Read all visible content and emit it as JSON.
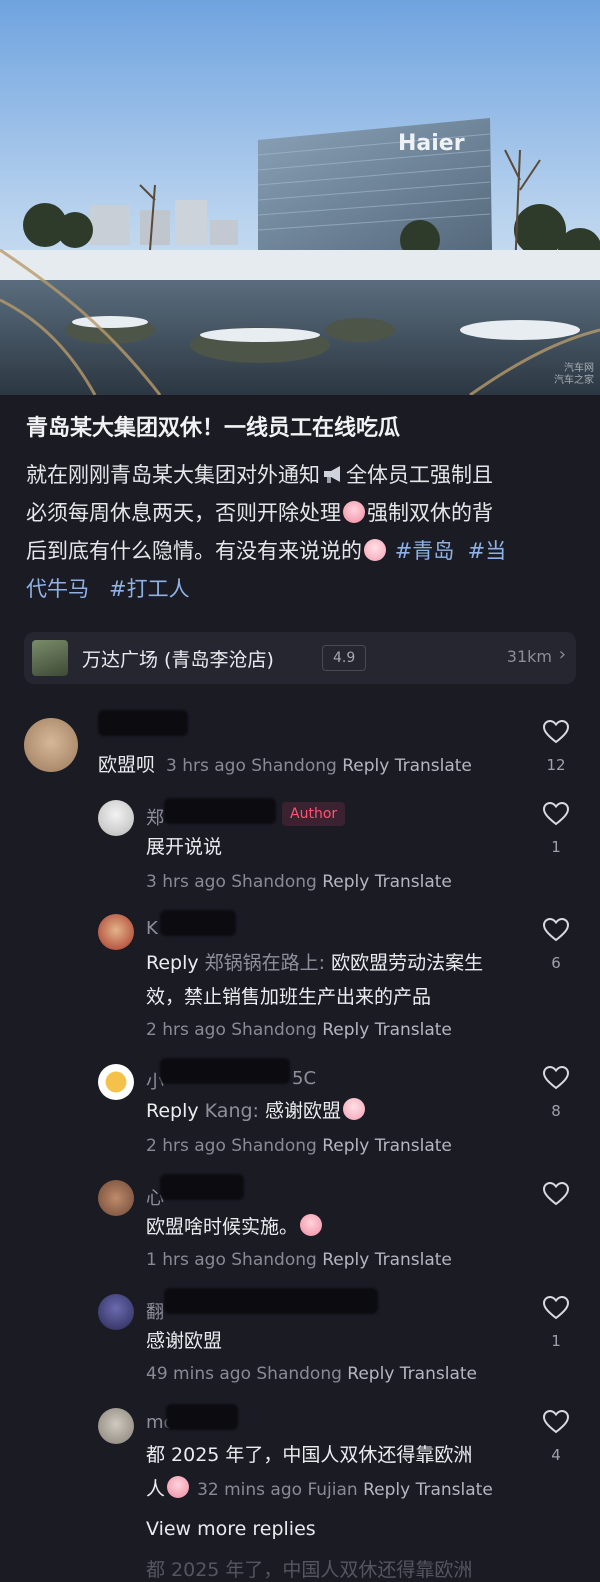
{
  "post": {
    "title": "青岛某大集团双休！一线员工在线吃瓜",
    "body_line1": "就在刚刚青岛某大集团对外通知",
    "body_line1b": "全体员工强制且",
    "body_line2": "必须每周休息两天，否则开除处理",
    "body_line2b": "强制双休的背",
    "body_line3": "后到底有什么隐情。有没有来说说的",
    "tag1": "#青岛",
    "tag2": "#当",
    "tag2b": "代牛马",
    "tag3": "#打工人",
    "hero_sign": "Haier",
    "watermark1": "汽车网",
    "watermark2": "汽车之家"
  },
  "location": {
    "name": "万达广场 (青岛李沧店)",
    "score": "4.9",
    "distance": "31km",
    "chevron": ">"
  },
  "comments": [
    {
      "name_visible": "",
      "text": "欧盟呗",
      "meta_time": "3 hrs ago",
      "meta_region": "Shandong",
      "reply": "Reply",
      "translate": "Translate",
      "likes": "12"
    },
    {
      "name_visible": "郑",
      "author_badge": "Author",
      "text": "展开说说",
      "meta_time": "3 hrs ago",
      "meta_region": "Shandong",
      "reply": "Reply",
      "translate": "Translate",
      "likes": "1"
    },
    {
      "name_visible": "K",
      "reply_prefix": "Reply",
      "reply_to": "郑锅锅在路上:",
      "text_line1": "欧欧盟劳动法案生",
      "text_line2": "效，禁止销售加班生产出来的产品",
      "meta_time": "2 hrs ago",
      "meta_region": "Shandong",
      "reply": "Reply",
      "translate": "Translate",
      "likes": "6"
    },
    {
      "name_visible": "小",
      "name_tail": "5C",
      "reply_prefix": "Reply",
      "reply_to": "Kang:",
      "text": "感谢欧盟",
      "meta_time": "2 hrs ago",
      "meta_region": "Shandong",
      "reply": "Reply",
      "translate": "Translate",
      "likes": "8"
    },
    {
      "name_visible": "心",
      "text": "欧盟啥时候实施。",
      "meta_time": "1 hrs ago",
      "meta_region": "Shandong",
      "reply": "Reply",
      "translate": "Translate",
      "likes": ""
    },
    {
      "name_visible": "翻",
      "text": "感谢欧盟",
      "meta_time": "49 mins ago",
      "meta_region": "Shandong",
      "reply": "Reply",
      "translate": "Translate",
      "likes": "1"
    },
    {
      "name_visible": "mo",
      "text_line1": "都 2025 年了，中国人双休还得靠欧洲",
      "text_line2": "人",
      "meta_time": "32 mins ago",
      "meta_region": "Fujian",
      "reply": "Reply",
      "translate": "Translate",
      "likes": "4"
    }
  ],
  "view_more": "View more replies",
  "bottom_cut": "都 2025 年了，中国人双休还得靠欧洲",
  "icons": [
    "heart-icon",
    "megaphone-icon",
    "crying-emoji-icon",
    "shocked-emoji-icon",
    "chevron-right-icon"
  ]
}
